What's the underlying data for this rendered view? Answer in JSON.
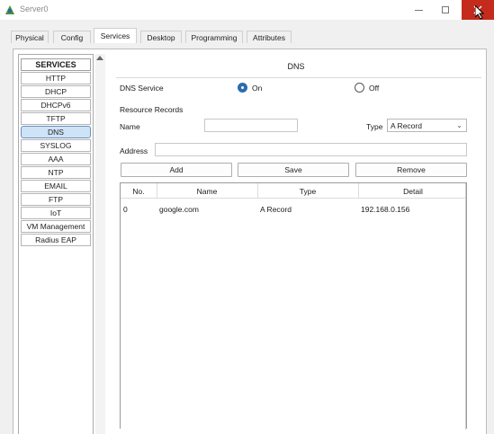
{
  "window": {
    "title": "Server0"
  },
  "tabs": [
    {
      "label": "Physical"
    },
    {
      "label": "Config"
    },
    {
      "label": "Services"
    },
    {
      "label": "Desktop"
    },
    {
      "label": "Programming"
    },
    {
      "label": "Attributes"
    }
  ],
  "services": {
    "header": "SERVICES",
    "items": [
      {
        "label": "HTTP"
      },
      {
        "label": "DHCP"
      },
      {
        "label": "DHCPv6"
      },
      {
        "label": "TFTP"
      },
      {
        "label": "DNS"
      },
      {
        "label": "SYSLOG"
      },
      {
        "label": "AAA"
      },
      {
        "label": "NTP"
      },
      {
        "label": "EMAIL"
      },
      {
        "label": "FTP"
      },
      {
        "label": "IoT"
      },
      {
        "label": "VM Management"
      },
      {
        "label": "Radius EAP"
      }
    ],
    "selected": "DNS"
  },
  "dns": {
    "title": "DNS",
    "service_label": "DNS Service",
    "on_label": "On",
    "off_label": "Off",
    "resource_records_label": "Resource Records",
    "name_label": "Name",
    "name_value": "",
    "type_label": "Type",
    "type_value": "A Record",
    "address_label": "Address",
    "address_value": "",
    "add_label": "Add",
    "save_label": "Save",
    "remove_label": "Remove",
    "table": {
      "headers": [
        "No.",
        "Name",
        "Type",
        "Detail"
      ],
      "rows": [
        {
          "no": "0",
          "name": "google.com",
          "type": "A Record",
          "detail": "192.168.0.156"
        }
      ]
    }
  },
  "colors": {
    "selected_bg": "#cfe3f7",
    "radio_on": "#2b6cb0",
    "close_btn": "#c42b1c"
  }
}
